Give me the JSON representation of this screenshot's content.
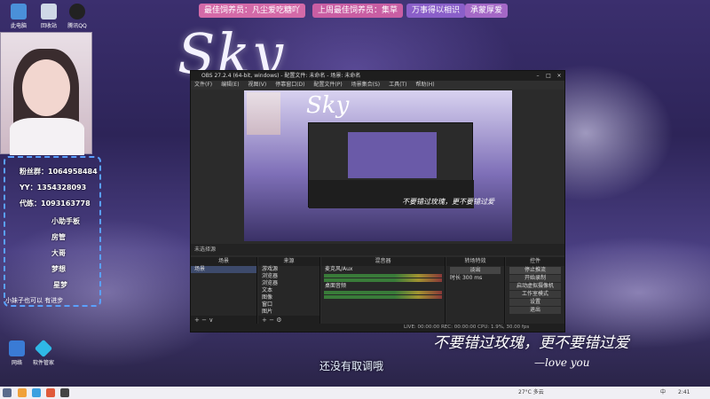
{
  "banner": {
    "b1": "最佳饲养员：凡尘爱吃糖吖",
    "b2": "上周最佳饲养员：集草",
    "b3": "万事得以相识",
    "b4": "承蒙厚爱"
  },
  "wallpaper_title": "Sky",
  "desktop_icons": [
    {
      "label": "此电脑"
    },
    {
      "label": "回收站"
    },
    {
      "label": "腾讯QQ"
    },
    {
      "label": "网络"
    },
    {
      "label": "软件管家"
    }
  ],
  "stats": {
    "line1": "粉丝群：1064958484",
    "line2": "YY：1354328093",
    "line3": "代练：1093163778",
    "line4": "小助手板",
    "line5": "房管",
    "line6": "大哥",
    "line7": "梦想",
    "line8": "星梦",
    "tag": "小妹子也可以 有进步"
  },
  "obs": {
    "title": "OBS 27.2.4 (64-bit, windows) - 配置文件: 未命名 - 场景: 未命名",
    "menu": [
      "文件(F)",
      "编辑(E)",
      "视图(V)",
      "停靠窗口(D)",
      "配置文件(P)",
      "场景集合(S)",
      "工具(T)",
      "帮助(H)"
    ],
    "preview_title": "Sky",
    "preview_subtitle": "不要错过玫瑰，更不要错过爱",
    "source_bar": "未选择源",
    "docks": {
      "scenes": {
        "header": "场景",
        "items": [
          "场景"
        ]
      },
      "sources": {
        "header": "来源",
        "items": [
          "游戏源",
          "浏览器",
          "浏览器",
          "文本",
          "图像",
          "窗口",
          "图片"
        ]
      },
      "mixer": {
        "header": "混音器",
        "tracks": [
          "麦克风/Aux",
          "桌面音频"
        ]
      },
      "transitions": {
        "header": "转场特效",
        "type": "淡出",
        "duration_label": "时长",
        "duration": "300 ms"
      },
      "controls": {
        "header": "控件",
        "buttons": [
          "停止推流",
          "开始录制",
          "启动虚拟摄像机",
          "工作室模式",
          "设置",
          "退出"
        ]
      }
    },
    "status": "LIVE: 00:00:00   REC: 00:00:00   CPU: 1.9%, 30.00 fps"
  },
  "live_text": "还没有取调哦",
  "calligraphy": "不要错过玫瑰，更不要错过爱",
  "calligraphy_sig": "—love you",
  "taskbar": {
    "weather": "27°C 多云",
    "lang": "中",
    "time": "2:41"
  },
  "colors": {
    "accent_pink": "#d46aa8",
    "accent_purple": "#8a5fc9",
    "obs_bg": "#2b2b2b"
  }
}
